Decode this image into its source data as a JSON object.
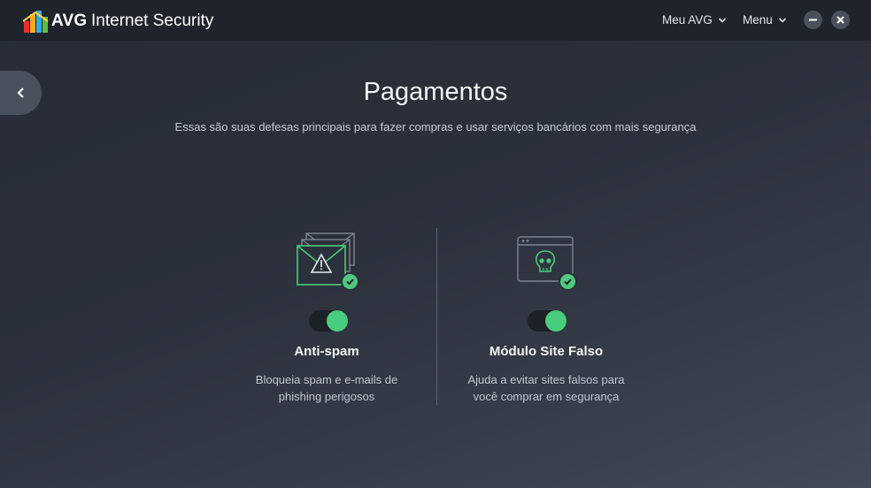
{
  "app": {
    "brand": "AVG",
    "product": "Internet Security"
  },
  "topnav": {
    "meu_avg": "Meu AVG",
    "menu": "Menu"
  },
  "page": {
    "title": "Pagamentos",
    "subtitle": "Essas são suas defesas principais para fazer compras e usar serviços bancários com mais segurança"
  },
  "features": [
    {
      "title": "Anti-spam",
      "desc_line1": "Bloqueia spam e e-mails de",
      "desc_line2": "phishing perigosos",
      "icon": "envelope-warning-icon",
      "enabled": true
    },
    {
      "title": "Módulo Site Falso",
      "desc_line1": "Ajuda a evitar sites falsos para",
      "desc_line2": "você comprar em segurança",
      "icon": "fake-site-skull-icon",
      "enabled": true
    }
  ],
  "colors": {
    "accent_green": "#49cc7d",
    "titlebar": "#1f232b",
    "background": "#2b303b"
  }
}
